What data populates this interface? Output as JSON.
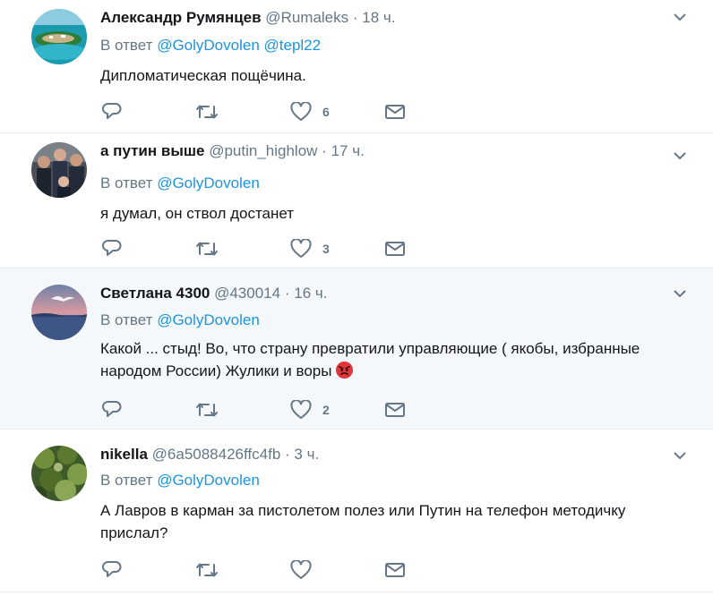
{
  "tweets": [
    {
      "name": "Александр Румянцев",
      "handle": "@Rumaleks",
      "time": "18 ч.",
      "reply_label": "В ответ",
      "reply_to": [
        "@GolyDovolen",
        "@tepl22"
      ],
      "text": "Дипломатическая пощёчина.",
      "likes": "6",
      "highlighted": false
    },
    {
      "name": "а путин выше",
      "handle": "@putin_highlow",
      "time": "17 ч.",
      "reply_label": "В ответ",
      "reply_to": [
        "@GolyDovolen"
      ],
      "text": "я думал, он ствол достанет",
      "likes": "3",
      "highlighted": false
    },
    {
      "name": "Светлана 4300",
      "handle": "@430014",
      "time": "16 ч.",
      "reply_label": "В ответ",
      "reply_to": [
        "@GolyDovolen"
      ],
      "text": "Какой ... стыд! Во, что страну превратили управляющие ( якобы, избранные народом России) Жулики и воры",
      "emoji": "angry-face",
      "likes": "2",
      "highlighted": true
    },
    {
      "name": "nikella",
      "handle": "@6a5088426ffc4fb",
      "time": "3 ч.",
      "reply_label": "В ответ",
      "reply_to": [
        "@GolyDovolen"
      ],
      "text": "А Лавров в карман за пистолетом полез или Путин на телефон методичку прислал?",
      "likes": "",
      "highlighted": false
    }
  ],
  "separator": "·",
  "colors": {
    "link": "#1b95e0",
    "muted": "#657786",
    "text": "#14171a",
    "highlight_bg": "#f5f8fa",
    "border": "#e6ecf0"
  }
}
